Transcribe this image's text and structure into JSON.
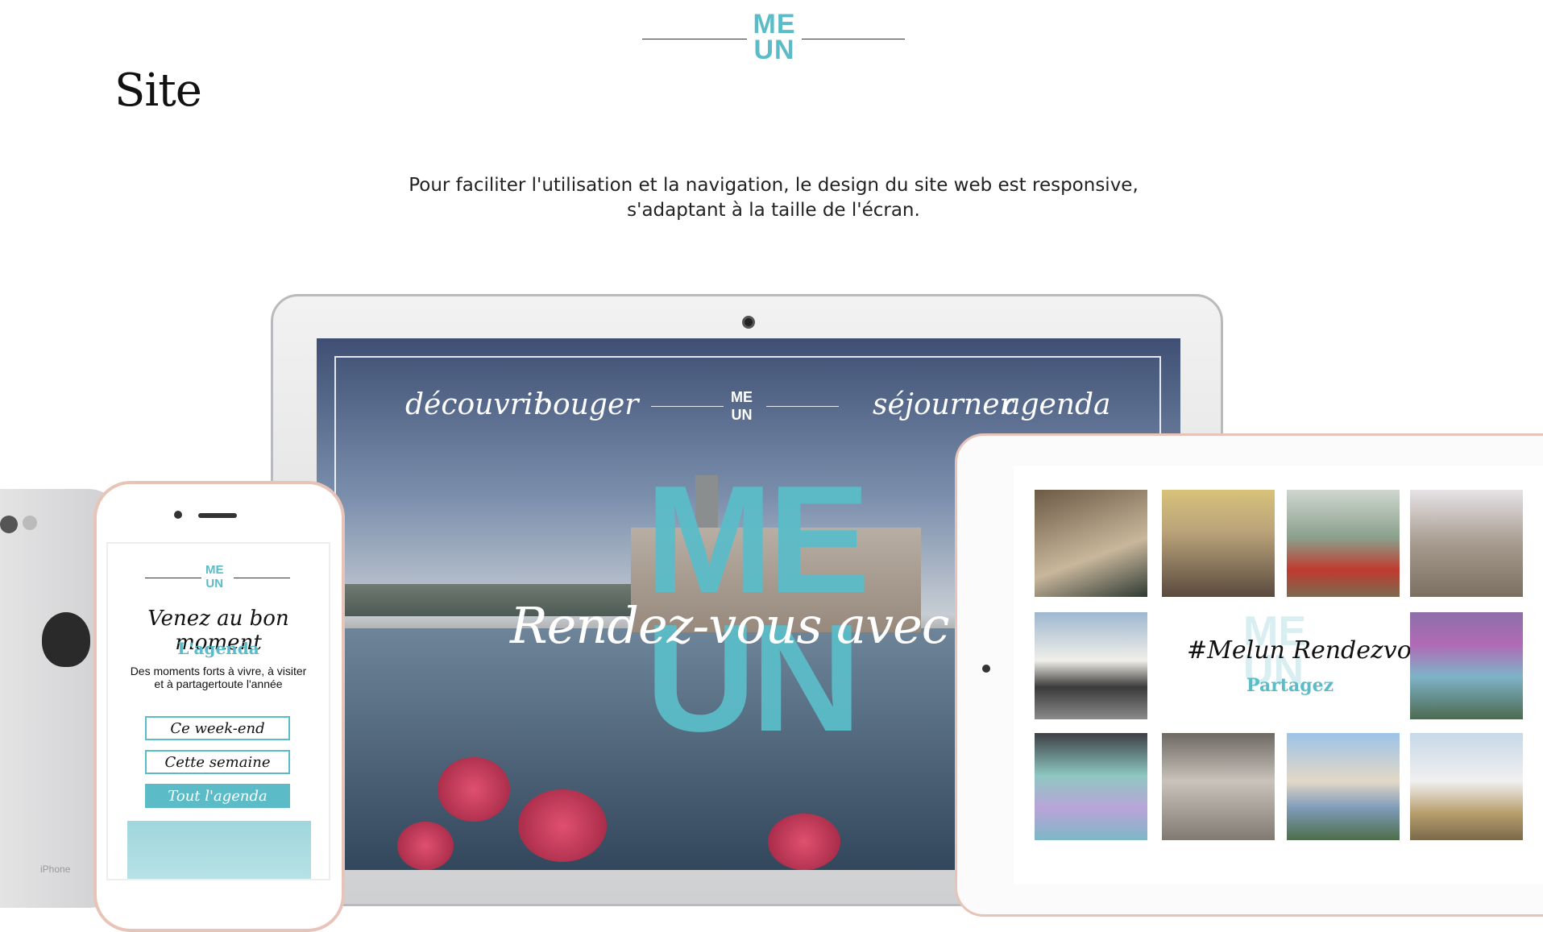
{
  "header": {
    "logo_top": "ME",
    "logo_bottom": "UN",
    "title": "Site",
    "intro": "Pour faciliter l'utilisation et la navigation, le design du site web est responsive, s'adaptant à la taille de l'écran."
  },
  "laptop": {
    "nav": [
      "découvrir",
      "bouger",
      "séjourner",
      "agenda"
    ],
    "logo_top": "ME",
    "logo_bottom": "UN",
    "hero_top": "ME",
    "hero_bottom": "UN",
    "tagline": "Rendez-vous avec (Vous-mê"
  },
  "phone": {
    "logo_top": "ME",
    "logo_bottom": "UN",
    "heading": "Venez au bon moment",
    "subheading": "L'agenda",
    "description": "Des moments forts à vivre, à visiter et à partagertoute l'année",
    "buttons": [
      "Ce week-end",
      "Cette semaine",
      "Tout l'agenda"
    ],
    "back_label": "iPhone"
  },
  "tablet": {
    "hashtag": "#Melun Rendezvous",
    "share_label": "Partagez",
    "ghost_logo_top": "ME",
    "ghost_logo_bottom": "UN"
  },
  "colors": {
    "accent": "#5bbcc8",
    "phone_rim": "#e8c4b8"
  }
}
